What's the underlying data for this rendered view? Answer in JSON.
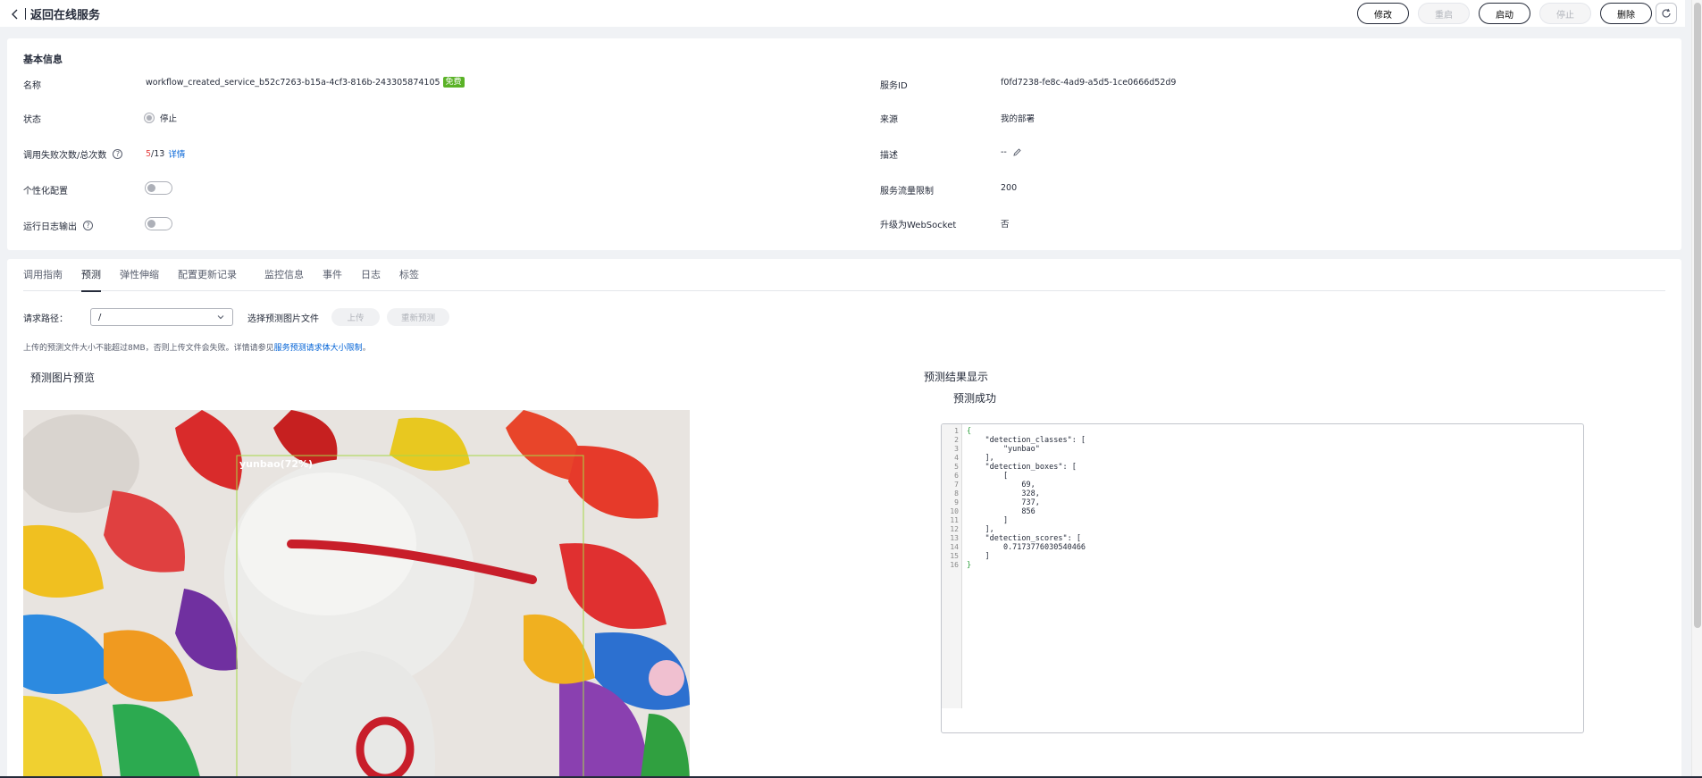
{
  "header": {
    "back_label": "返回在线服务",
    "buttons": [
      {
        "label": "修改",
        "disabled": false
      },
      {
        "label": "重启",
        "disabled": true
      },
      {
        "label": "启动",
        "disabled": false
      },
      {
        "label": "停止",
        "disabled": true
      },
      {
        "label": "删除",
        "disabled": false
      }
    ]
  },
  "basic": {
    "title": "基本信息",
    "name_label": "名称",
    "name_value": "workflow_created_service_b52c7263-b15a-4cf3-816b-243305874105",
    "name_tag": "免费",
    "status_label": "状态",
    "status_value": "停止",
    "calls_label": "调用失败次数/总次数",
    "calls_failed": "5",
    "calls_total": "/13",
    "calls_link": "详情",
    "personal_label": "个性化配置",
    "log_label": "运行日志输出",
    "id_label": "服务ID",
    "id_value": "f0fd7238-fe8c-4ad9-a5d5-1ce0666d52d9",
    "source_label": "来源",
    "source_value": "我的部署",
    "desc_label": "描述",
    "desc_value": "--",
    "flow_label": "服务流量限制",
    "flow_value": "200",
    "ws_label": "升级为WebSocket",
    "ws_value": "否"
  },
  "tabs": [
    "调用指南",
    "预测",
    "弹性伸缩",
    "配置更新记录",
    "监控信息",
    "事件",
    "日志",
    "标签"
  ],
  "active_tab": "预测",
  "predict": {
    "path_label": "请求路径：",
    "path_value": "/",
    "file_label": "选择预测图片文件",
    "upload_label": "上传",
    "repredict_label": "重新预测",
    "hint_prefix": "上传的预测文件大小不能超过8MB，否则上传文件会失败。详情请参见",
    "hint_link": "服务预测请求体大小限制",
    "hint_suffix": "。",
    "preview_title": "预测图片预览",
    "result_title": "预测结果显示",
    "success_label": "预测成功",
    "box_label": "yunbao(72%)",
    "code_lines": [
      "{",
      "    \"detection_classes\": [",
      "        \"yunbao\"",
      "    ],",
      "    \"detection_boxes\": [",
      "        [",
      "            69,",
      "            328,",
      "            737,",
      "            856",
      "        ]",
      "    ],",
      "    \"detection_scores\": [",
      "        0.7173776030540466",
      "    ]",
      "}"
    ]
  }
}
